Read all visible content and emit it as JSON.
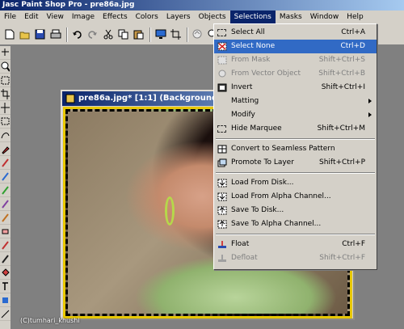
{
  "app": {
    "title": "Jasc Paint Shop Pro - pre86a.jpg"
  },
  "menu": [
    "File",
    "Edit",
    "View",
    "Image",
    "Effects",
    "Colors",
    "Layers",
    "Objects",
    "Selections",
    "Masks",
    "Window",
    "Help"
  ],
  "active_menu": "Selections",
  "document": {
    "title": "pre86a.jpg* [1:1] (Background)"
  },
  "watermark": "(C)tumhari_khushi",
  "selections_menu": {
    "select_all": {
      "label": "Select All",
      "shortcut": "Ctrl+A"
    },
    "select_none": {
      "label": "Select None",
      "shortcut": "Ctrl+D"
    },
    "from_mask": {
      "label": "From Mask",
      "shortcut": "Shift+Ctrl+S"
    },
    "from_vector_object": {
      "label": "From Vector Object",
      "shortcut": "Shift+Ctrl+B"
    },
    "invert": {
      "label": "Invert",
      "shortcut": "Shift+Ctrl+I"
    },
    "matting": {
      "label": "Matting"
    },
    "modify": {
      "label": "Modify"
    },
    "hide_marquee": {
      "label": "Hide Marquee",
      "shortcut": "Shift+Ctrl+M"
    },
    "convert_seamless": {
      "label": "Convert to Seamless Pattern"
    },
    "promote_to_layer": {
      "label": "Promote To Layer",
      "shortcut": "Shift+Ctrl+P"
    },
    "load_from_disk": {
      "label": "Load From Disk..."
    },
    "load_from_alpha": {
      "label": "Load From Alpha Channel..."
    },
    "save_to_disk": {
      "label": "Save To Disk..."
    },
    "save_to_alpha": {
      "label": "Save To Alpha Channel..."
    },
    "float": {
      "label": "Float",
      "shortcut": "Ctrl+F"
    },
    "defloat": {
      "label": "Defloat",
      "shortcut": "Shift+Ctrl+F"
    }
  },
  "colors": {
    "highlight": "#316ac5",
    "menu_bg": "#d4d0c8",
    "title_bar": "#0a246a",
    "workspace": "#808080",
    "marquee_border": "#e8c800"
  }
}
